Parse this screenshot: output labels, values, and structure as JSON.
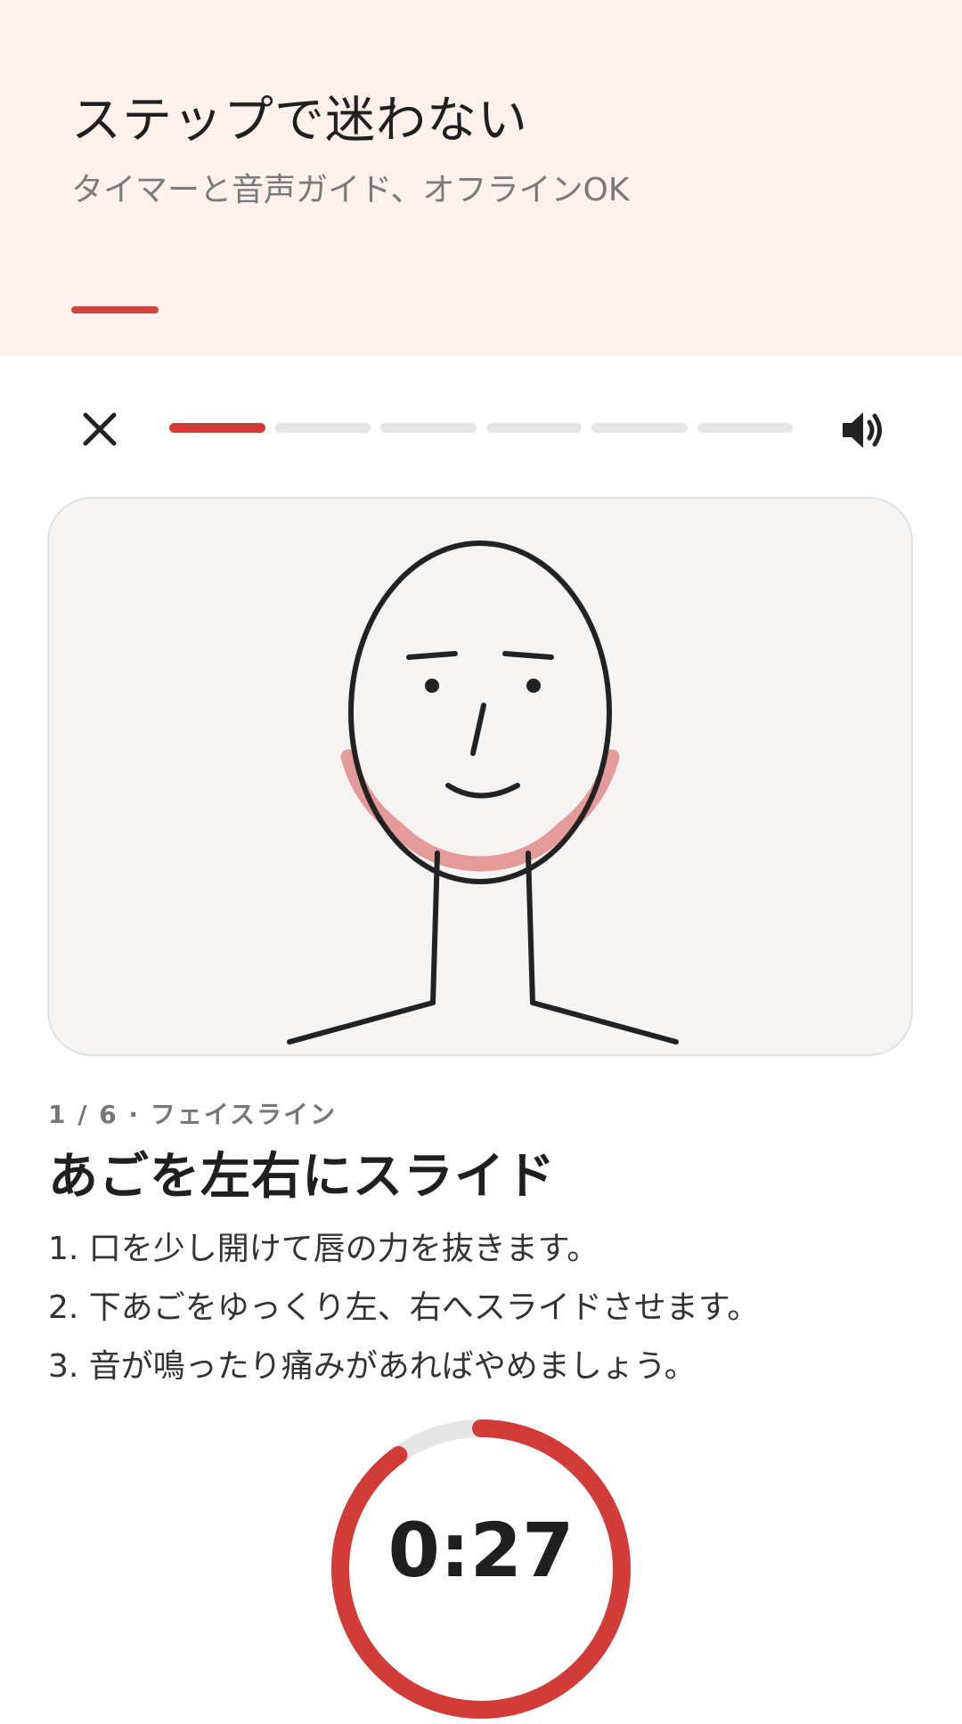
{
  "promo": {
    "title": "ステップで迷わない",
    "subtitle": "タイマーと音声ガイド、オフラインOK"
  },
  "toolbar": {
    "close_icon": "close-icon",
    "sound_icon": "speaker-volume-icon"
  },
  "progress": {
    "total_steps": 6,
    "current_step": 1
  },
  "illustration": {
    "icon": "face-jawline-illustration",
    "highlight_color": "#e39a98"
  },
  "step": {
    "meta": "1 / 6 · フェイスライン",
    "title": "あごを左右にスライド",
    "instructions": [
      "1. 口を少し開けて唇の力を抜きます。",
      "2. 下あごをゆっくり左、右へスライドさせます。",
      "3. 音が鳴ったり痛みがあればやめましょう。"
    ]
  },
  "timer": {
    "display": "0:27",
    "remaining_fraction": 0.9
  },
  "colors": {
    "accent": "#d23c38",
    "promo_bg": "#fdf1ee",
    "track": "#e6e6e6"
  }
}
